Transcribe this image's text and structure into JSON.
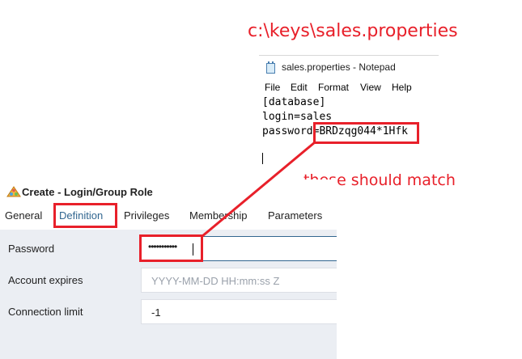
{
  "annotations": {
    "file_path": "c:\\keys\\sales.properties",
    "match_note": "these should match",
    "accent_color": "#e8202a"
  },
  "notepad": {
    "title": "sales.properties - Notepad",
    "icon": "notepad-icon",
    "menu": [
      "File",
      "Edit",
      "Format",
      "View",
      "Help"
    ],
    "lines": [
      "[database]",
      "login=sales",
      "password=BRDzqg044*1Hfk"
    ]
  },
  "dialog": {
    "title": "Create - Login/Group Role",
    "icon": "login-role-icon",
    "tabs": [
      "General",
      "Definition",
      "Privileges",
      "Membership",
      "Parameters"
    ],
    "active_tab": "Definition",
    "fields": [
      {
        "label": "Password",
        "value": "•••••••••••",
        "placeholder": ""
      },
      {
        "label": "Account expires",
        "value": "",
        "placeholder": "YYYY-MM-DD HH:mm:ss Z"
      },
      {
        "label": "Connection limit",
        "value": "-1",
        "placeholder": ""
      }
    ],
    "accent_color": "#326690"
  }
}
